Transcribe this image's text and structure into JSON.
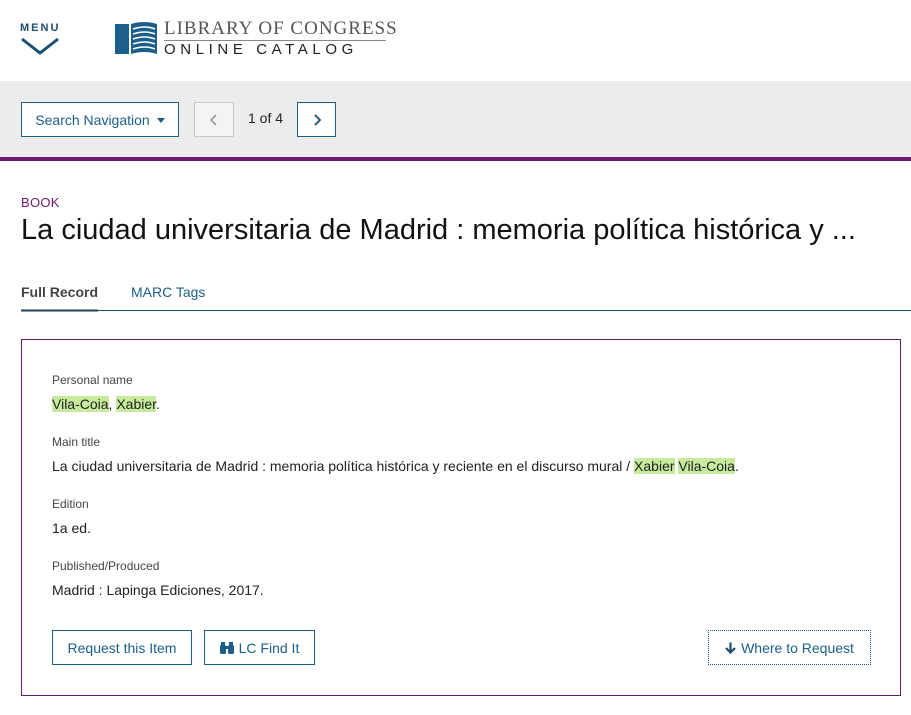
{
  "header": {
    "menu_label": "MENU",
    "logo_line1": "LIBRARY OF CONGRESS",
    "logo_line2": "ONLINE CATALOG"
  },
  "nav": {
    "search_navigation_label": "Search Navigation",
    "pager_text": "1 of 4"
  },
  "record": {
    "format": "BOOK",
    "title": "La ciudad universitaria de Madrid : memoria política histórica y ...",
    "tabs": [
      {
        "label": "Full Record",
        "active": true
      },
      {
        "label": "MARC Tags",
        "active": false
      }
    ],
    "fields": {
      "personal_name": {
        "label": "Personal name",
        "part1": "Vila-Coia",
        "sep": ", ",
        "part2": "Xabier",
        "end": "."
      },
      "main_title": {
        "label": "Main title",
        "prefix": "La ciudad universitaria de Madrid : memoria política histórica y reciente en el discurso mural / ",
        "hl1": "Xabier",
        "space": " ",
        "hl2": "Vila-Coia",
        "end": "."
      },
      "edition": {
        "label": "Edition",
        "value": "1a ed."
      },
      "published": {
        "label": "Published/Produced",
        "value": "Madrid : Lapinga Ediciones, 2017."
      }
    },
    "actions": {
      "request_label": "Request this Item",
      "findit_label": "LC Find It",
      "where_label": "Where to Request"
    }
  },
  "colors": {
    "brand_purple": "#6e1a6e",
    "link_blue": "#1b5f8a",
    "highlight_green": "#c6eb9c",
    "nav_band_gray": "#ececec"
  },
  "icons": [
    "chevron-down-icon",
    "loc-book-logo-icon",
    "caret-down-icon",
    "chevron-left-icon",
    "chevron-right-icon",
    "binoculars-icon",
    "arrow-down-icon"
  ]
}
